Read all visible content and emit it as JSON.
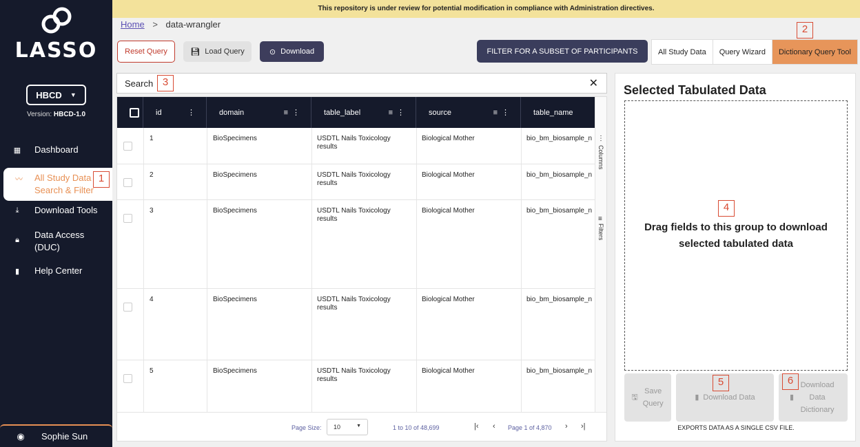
{
  "banner": "This repository is under review for potential modification in compliance with Administration directives.",
  "logo": "LASSO",
  "study_select": "HBCD",
  "version_label": "Version:",
  "version_value": "HBCD-1.0",
  "nav": [
    {
      "label": "Dashboard",
      "icon": "dashboard-icon"
    },
    {
      "label": "All Study Data Search & Filter",
      "icon": "search-filter-icon"
    },
    {
      "label": "Download Tools",
      "icon": "download-icon"
    },
    {
      "label": "Data Access (DUC)",
      "icon": "lock-icon"
    },
    {
      "label": "Help Center",
      "icon": "book-icon"
    }
  ],
  "user": "Sophie Sun",
  "breadcrumb": {
    "home": "Home",
    "separator": ">",
    "current": "data-wrangler"
  },
  "toolbar": {
    "reset": "Reset Query",
    "load": "Load Query",
    "download": "Download",
    "filter": "FILTER FOR A SUBSET OF PARTICIPANTS"
  },
  "tabs": [
    "All Study Data",
    "Query Wizard",
    "Dictionary Query Tool"
  ],
  "search": {
    "label": "Search"
  },
  "grid": {
    "columns": [
      "id",
      "domain",
      "table_label",
      "source",
      "table_name"
    ],
    "rows": [
      {
        "id": "1",
        "domain": "BioSpecimens",
        "table_label": "USDTL Nails Toxicology results",
        "source": "Biological Mother",
        "table_name": "bio_bm_biosample_n"
      },
      {
        "id": "2",
        "domain": "BioSpecimens",
        "table_label": "USDTL Nails Toxicology results",
        "source": "Biological Mother",
        "table_name": "bio_bm_biosample_n"
      },
      {
        "id": "3",
        "domain": "BioSpecimens",
        "table_label": "USDTL Nails Toxicology results",
        "source": "Biological Mother",
        "table_name": "bio_bm_biosample_n"
      },
      {
        "id": "4",
        "domain": "BioSpecimens",
        "table_label": "USDTL Nails Toxicology results",
        "source": "Biological Mother",
        "table_name": "bio_bm_biosample_n"
      },
      {
        "id": "5",
        "domain": "BioSpecimens",
        "table_label": "USDTL Nails Toxicology results",
        "source": "Biological Mother",
        "table_name": "bio_bm_biosample_n"
      }
    ],
    "side_columns": "Columns",
    "side_filters": "Filters"
  },
  "pager": {
    "page_size_label": "Page Size:",
    "page_size": "10",
    "range": "1 to 10 of 48,699",
    "page_info": "Page 1 of 4,870"
  },
  "panel": {
    "title": "Selected Tabulated Data",
    "drop_line1": "Drag fields to this group to download",
    "drop_line2": "selected tabulated data",
    "save": "Save Query",
    "download_data": "Download Data",
    "download_dict": "Download Data Dictionary",
    "exports": "EXPORTS DATA AS A SINGLE CSV FILE."
  },
  "callouts": [
    "1",
    "2",
    "3",
    "4",
    "5",
    "6"
  ],
  "colors": {
    "sidebar": "#151a2b",
    "accent": "#e89054",
    "banner": "#f3e29b",
    "danger": "#c0392b"
  }
}
